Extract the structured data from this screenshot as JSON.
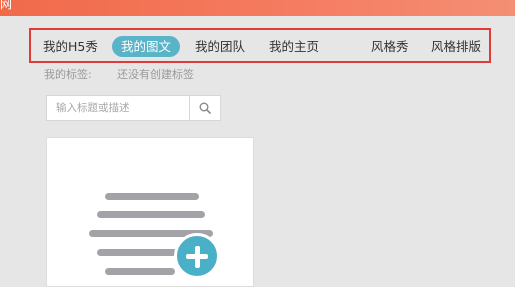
{
  "topbar": {
    "fragment_text": "网"
  },
  "nav": {
    "items": [
      {
        "label": "我的H5秀",
        "active": false
      },
      {
        "label": "我的图文",
        "active": true
      },
      {
        "label": "我的团队",
        "active": false
      },
      {
        "label": "我的主页",
        "active": false
      },
      {
        "label": "风格秀",
        "active": false
      },
      {
        "label": "风格排版",
        "active": false
      }
    ]
  },
  "tags": {
    "label": "我的标签:",
    "empty_text": "还没有创建标签"
  },
  "search": {
    "placeholder": "输入标题或描述",
    "value": "",
    "icon": "search-icon"
  },
  "create_card": {
    "icon": "plus-icon",
    "illustration": "document-lines"
  },
  "colors": {
    "topbar": "#f06a4a",
    "active_tab": "#5ab4c8",
    "highlight_border": "#e03a3a",
    "plus_button": "#4ab0c7"
  }
}
